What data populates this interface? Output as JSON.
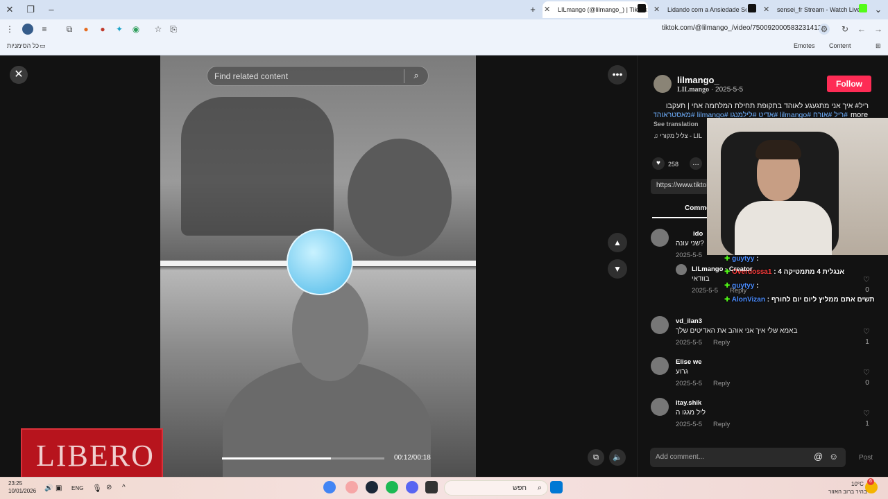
{
  "browser": {
    "tabs": [
      {
        "label": "LILmango (@lilmango_) | TikTok",
        "active": true
      },
      {
        "label": "Lidando com a Ansiedade Social"
      },
      {
        "label": "sensei_fr Stream - Watch Live on Kick"
      }
    ],
    "url": "tiktok.com/@lilmango_/video/7500920005832314120",
    "bookmarks_all": "כל הסימניות",
    "bookmarks_right": [
      "Emotes",
      "Content"
    ]
  },
  "video": {
    "search_placeholder": "Find related content",
    "time": "00:12/00:18",
    "progress": 0.67
  },
  "overlay_logo": "LIBERO",
  "post": {
    "username": "lilmango_",
    "nickname": "LILmango",
    "date": "2025-5-5",
    "follow_label": "Follow",
    "description": "ריל# איך אני מתגעגע לאוהד בתקופת תחילת המלחמה אחי | תעקבו",
    "hashtags": "#ריל #אורח #lilmango #אדיט #לילמנגו #lilmango #מאסטראוהד...",
    "more_label": "more",
    "see_translation": "See translation",
    "music": "צליל מקורי - LIL",
    "likes": "258",
    "share_url": "https://www.tiktok",
    "comments_tab": "Comments"
  },
  "chat_overlay": [
    {
      "name": "guytyy",
      "text": ":"
    },
    {
      "name": "Overdossa1",
      "text": ": אנגלית 4 מתמטיקה 4"
    },
    {
      "name": "guytyy",
      "text": ":"
    },
    {
      "name": "AlonVizan",
      "text": ": תשים אתם ממליץ ליום יום לחורף"
    }
  ],
  "comments": [
    {
      "user": "ido",
      "text": "שני עונה?",
      "date": "2025-5-5",
      "likes": ""
    },
    {
      "user": "LILmango · Creator",
      "text": "בוודאי",
      "date": "2025-5-5",
      "reply": "Reply",
      "likes": "0"
    },
    {
      "user": "vd_ilan3",
      "text": "באמא שלי איך אני אוהב את האדיטים שלך",
      "date": "2025-5-5",
      "reply": "Reply",
      "likes": "1"
    },
    {
      "user": "Elise we",
      "text": "גרוע",
      "date": "2025-5-5",
      "reply": "Reply",
      "likes": "0"
    },
    {
      "user": "itay.shik",
      "text": "ליל מגגו ה",
      "date": "2025-5-5",
      "reply": "Reply",
      "likes": "1"
    }
  ],
  "comment_box": {
    "placeholder": "Add comment...",
    "post_label": "Post"
  },
  "taskbar": {
    "time": "23:25",
    "date": "10/01/2026",
    "lang": "ENG",
    "search": "חפש",
    "weather_temp": "10°C",
    "weather_desc": "בהיר ברוב האזור",
    "notif_count": "6"
  }
}
